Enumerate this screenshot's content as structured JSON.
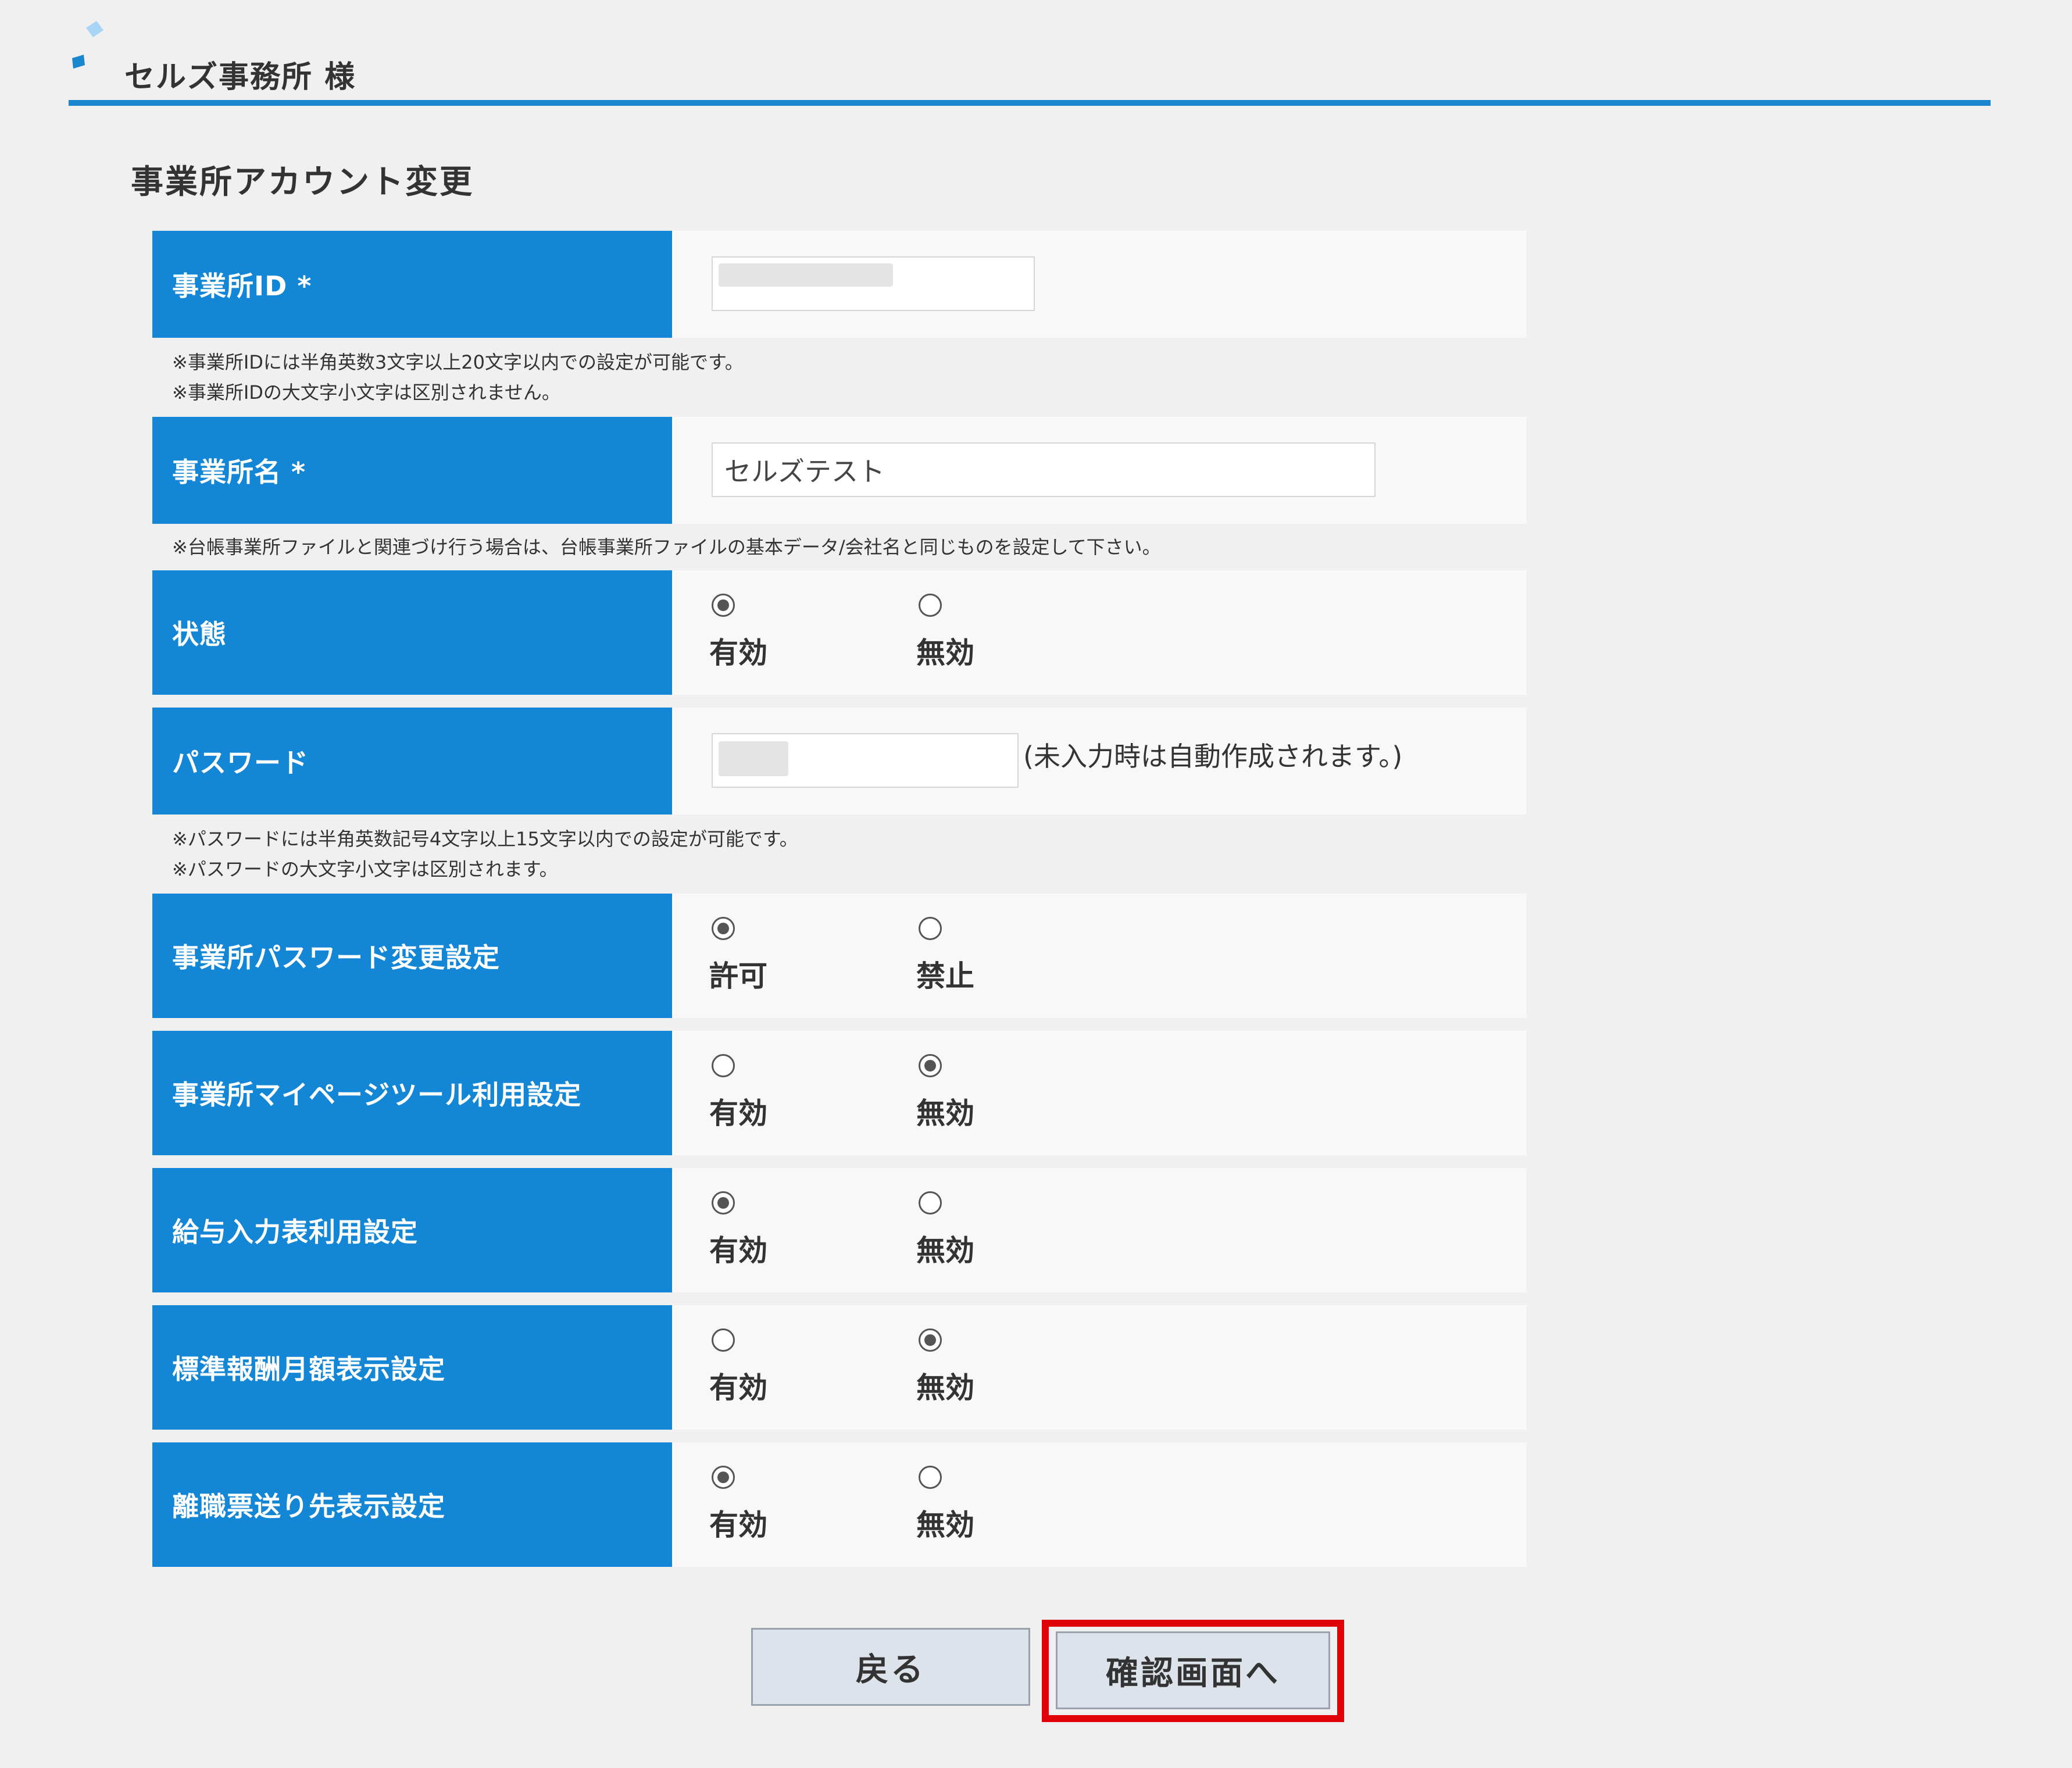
{
  "header": {
    "title": "セルズ事務所 様"
  },
  "page_title": "事業所アカウント変更",
  "colors": {
    "accent": "#1486d6",
    "highlight": "#e0000a"
  },
  "fields": {
    "office_id": {
      "label": "事業所ID *",
      "value": ""
    },
    "office_id_notes": [
      "※事業所IDには半角英数3文字以上20文字以内での設定が可能です。",
      "※事業所IDの大文字小文字は区別されません。"
    ],
    "office_name": {
      "label": "事業所名 *",
      "value": "セルズテスト"
    },
    "office_name_note": "※台帳事業所ファイルと関連づけ行う場合は、台帳事業所ファイルの基本データ/会社名と同じものを設定して下さい。",
    "status": {
      "label": "状態",
      "options": [
        "有効",
        "無効"
      ],
      "selected": "有効"
    },
    "password": {
      "label": "パスワード",
      "value": "",
      "hint": "(未入力時は自動作成されます。)"
    },
    "password_notes": [
      "※パスワードには半角英数記号4文字以上15文字以内での設定が可能です。",
      "※パスワードの大文字小文字は区別されます。"
    ],
    "password_change": {
      "label": "事業所パスワード変更設定",
      "options": [
        "許可",
        "禁止"
      ],
      "selected": "許可"
    },
    "mypage_tool": {
      "label": "事業所マイページツール利用設定",
      "options": [
        "有効",
        "無効"
      ],
      "selected": "無効"
    },
    "salary_input": {
      "label": "給与入力表利用設定",
      "options": [
        "有効",
        "無効"
      ],
      "selected": "有効"
    },
    "standard_remuneration": {
      "label": "標準報酬月額表示設定",
      "options": [
        "有効",
        "無効"
      ],
      "selected": "無効"
    },
    "separation_slip": {
      "label": "離職票送り先表示設定",
      "options": [
        "有効",
        "無効"
      ],
      "selected": "有効"
    }
  },
  "buttons": {
    "back": "戻る",
    "confirm": "確認画面へ"
  }
}
